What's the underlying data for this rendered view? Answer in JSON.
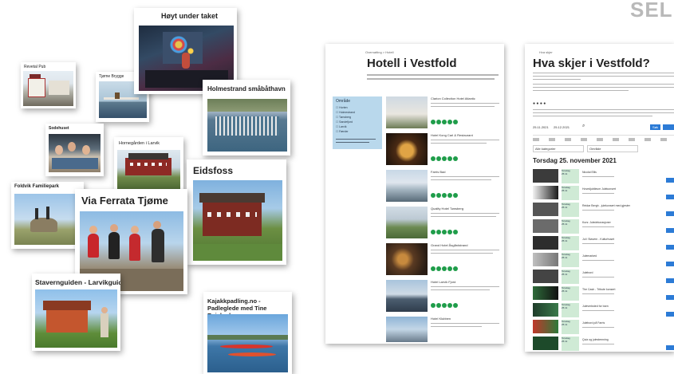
{
  "brand": "SELI",
  "cards": {
    "revetal": "Revetal Pub",
    "quay": "Tjøme Brygge",
    "hoyt": "Høyt under taket",
    "holmestrand": "Holmestrand småbåthavn",
    "sodehuset": "Sodehuset",
    "horne": "Hornegården i Larvik",
    "eidsfoss": "Eidsfoss",
    "foldvik": "Foldvik Familiepark",
    "ferrata": "Via Ferrata Tjøme",
    "stavern": "Stavernguiden - Larvikguiden",
    "kajakk": "Kajakkpadling.no - Padleglede med Tine Raisbæk"
  },
  "hotel_doc": {
    "breadcrumb": "Overnatting  >  Hotell",
    "title": "Hotell i Vestfold",
    "sidebar_title": "Område",
    "sidebar_items": [
      "Horten",
      "Holmestrand",
      "Tønsberg",
      "Sandefjord",
      "Larvik",
      "Færder"
    ],
    "hotels": [
      {
        "name": "Clarion Collection Hotel Atlantic"
      },
      {
        "name": "Hotel Kong Carl & Restaurant"
      },
      {
        "name": "Farris Bad"
      },
      {
        "name": "Quality Hotel Tønsberg"
      },
      {
        "name": "Grand Hotel Åsgårdstrand"
      },
      {
        "name": "Hotel Larvik Fjord"
      },
      {
        "name": "Hotel Klubben"
      }
    ]
  },
  "events_doc": {
    "breadcrumb": "Hva skjer",
    "title": "Hva skjer i Vestfold?",
    "date_heading": "Torsdag 25. november 2021",
    "filter_date": "25.11.2021",
    "filter_date2": "25.12.2021",
    "filter_btn": "Søk",
    "category_label": "Alle kategorier",
    "area_label": "Område",
    "row_day": "Torsdag",
    "row_date": "25.11",
    "events": [
      {
        "name": "Nicolai Ellis"
      },
      {
        "name": "Hovedjubileum Julekonsert"
      },
      {
        "name": "Reidar Bergh - julekonsert med gjester"
      },
      {
        "name": "Kurs: Juledekorasjoner"
      },
      {
        "name": "Jul i Stavern - Kulturhuset"
      },
      {
        "name": "Julemarked"
      },
      {
        "name": "Julebord"
      },
      {
        "name": "The Cash - Tribute konsert"
      },
      {
        "name": "Juleverksted for barn"
      },
      {
        "name": "Julebord på Farris"
      },
      {
        "name": "Quiz og julestemning"
      }
    ]
  }
}
